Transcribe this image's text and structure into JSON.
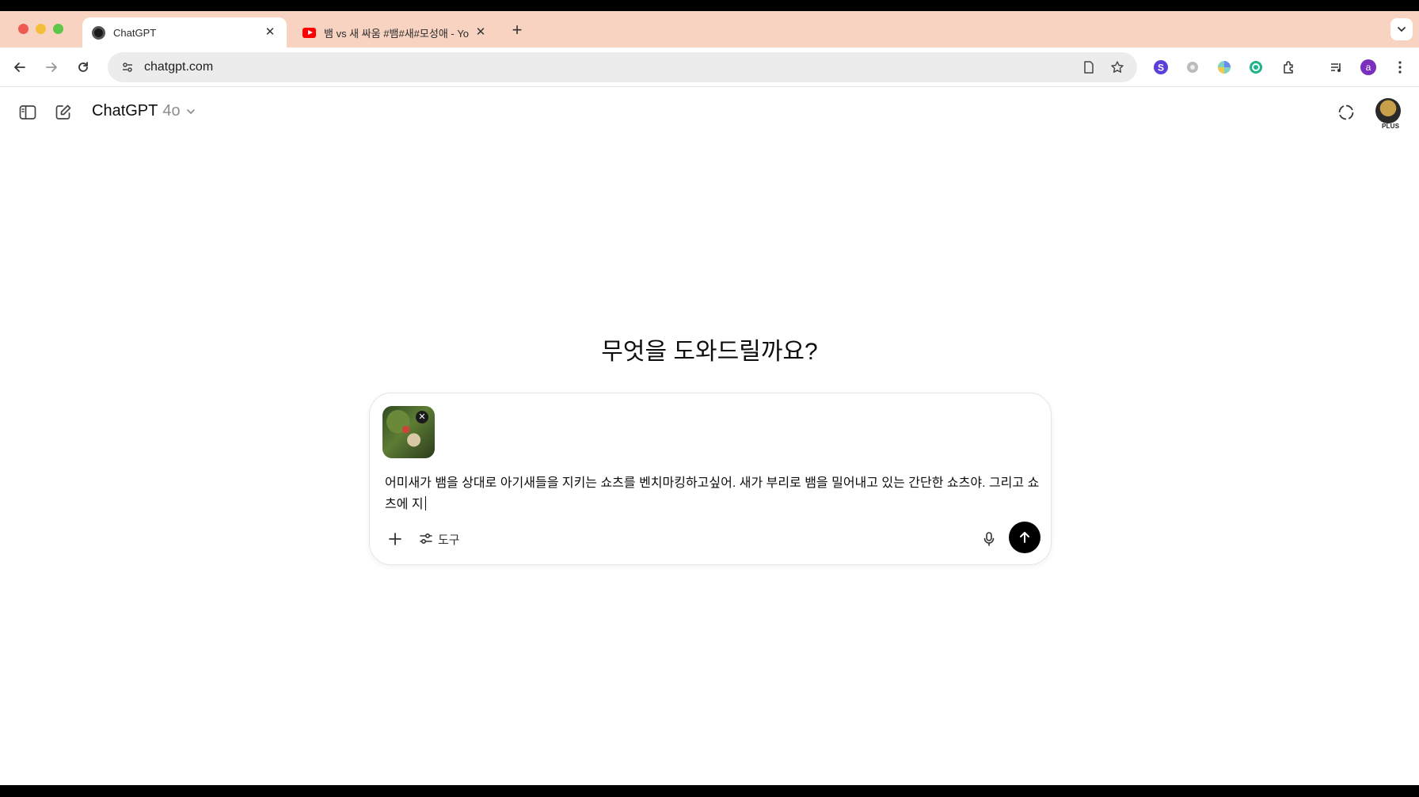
{
  "browser": {
    "tabs": [
      {
        "title": "ChatGPT",
        "close": "✕"
      },
      {
        "title": "뱀 vs 새 싸움 #뱀#새#모성애 - Yo",
        "close": "✕"
      }
    ],
    "new_tab": "+",
    "url": "chatgpt.com",
    "extension_avatar_letter": "a"
  },
  "app": {
    "model_name": "ChatGPT",
    "model_version": "4o",
    "plan_badge": "PLUS",
    "headline": "무엇을 도와드릴까요?"
  },
  "composer": {
    "attachment_remove": "✕",
    "text": "어미새가 뱀을 상대로 아기새들을 지키는 쇼츠를 벤치마킹하고싶어. 새가 부리로 뱀을 밀어내고 있는 간단한 쇼츠야. 그리고 쇼츠에 지",
    "tools_label": "도구"
  },
  "colors": {
    "tab_strip": "#f8d3c2",
    "send_button": "#000000"
  }
}
